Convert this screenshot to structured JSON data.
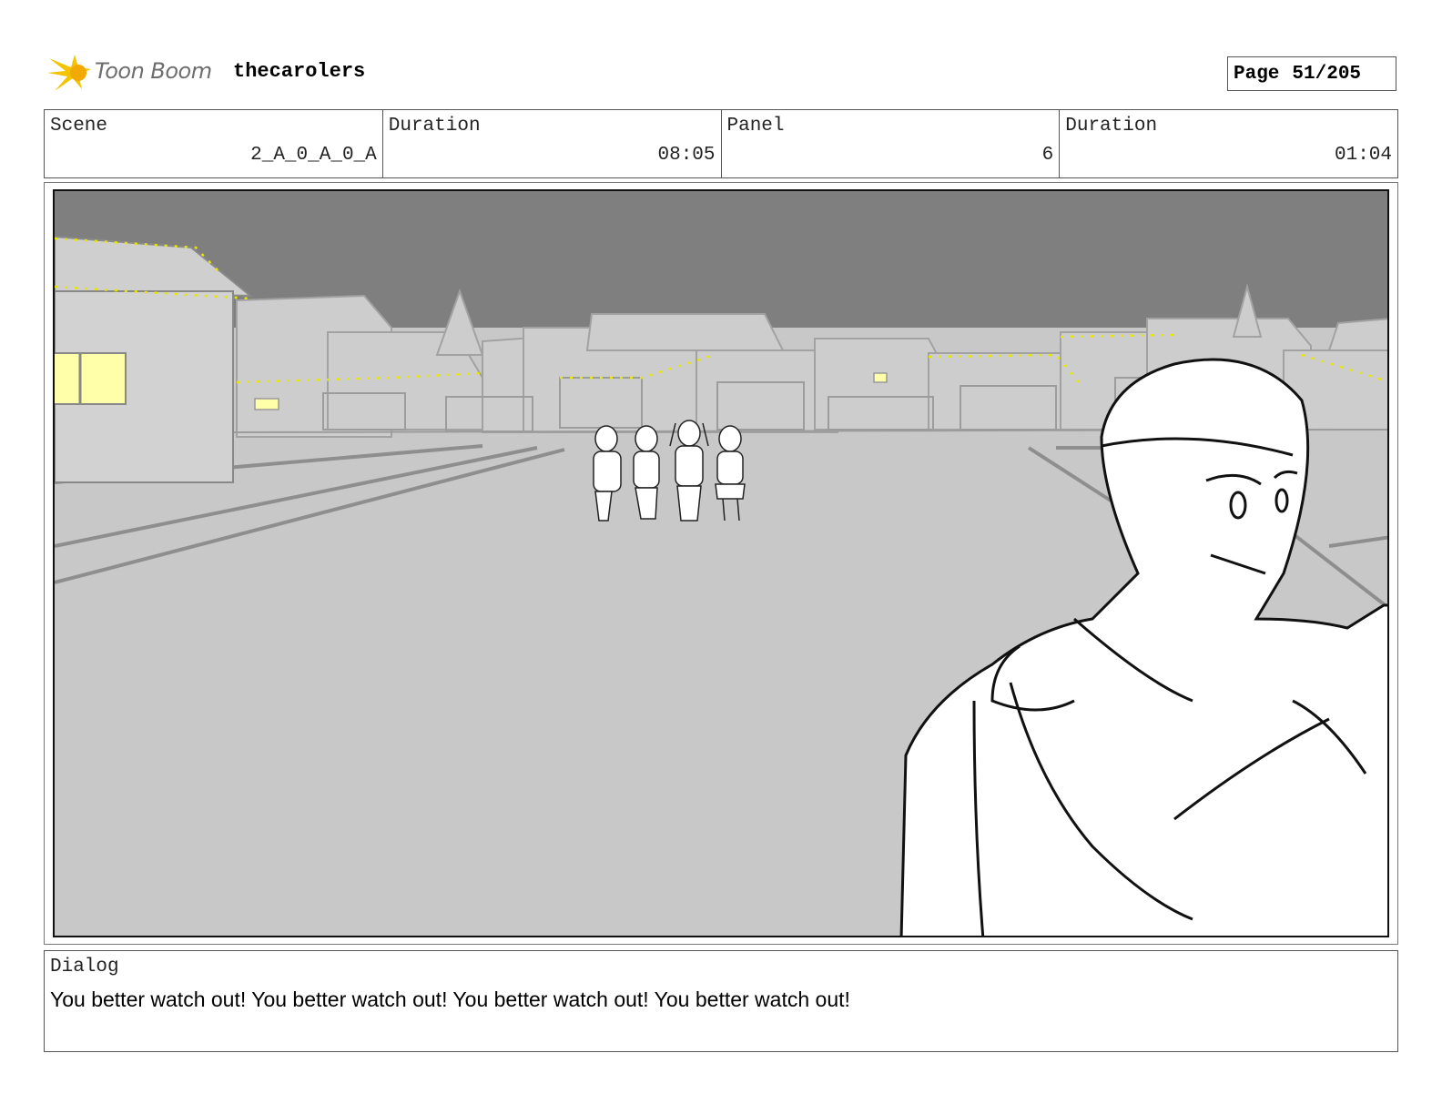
{
  "header": {
    "logo_text": "Toon Boom",
    "project_title": "thecarolers",
    "page_label": "Page",
    "page_value": "51/205"
  },
  "info": {
    "scene_label": "Scene",
    "scene_value": "2_A_0_A_0_A",
    "scene_duration_label": "Duration",
    "scene_duration_value": "08:05",
    "panel_label": "Panel",
    "panel_value": "6",
    "panel_duration_label": "Duration",
    "panel_duration_value": "01:04"
  },
  "dialog": {
    "label": "Dialog",
    "text": "You better watch out! You better watch out! You better watch out! You better watch out!"
  },
  "colors": {
    "logo_star": "#f5c400",
    "sky": "#7f7f7f",
    "ground": "#c8c8c8",
    "window_light": "#ffffaa",
    "string_lights": "#e8e800"
  }
}
